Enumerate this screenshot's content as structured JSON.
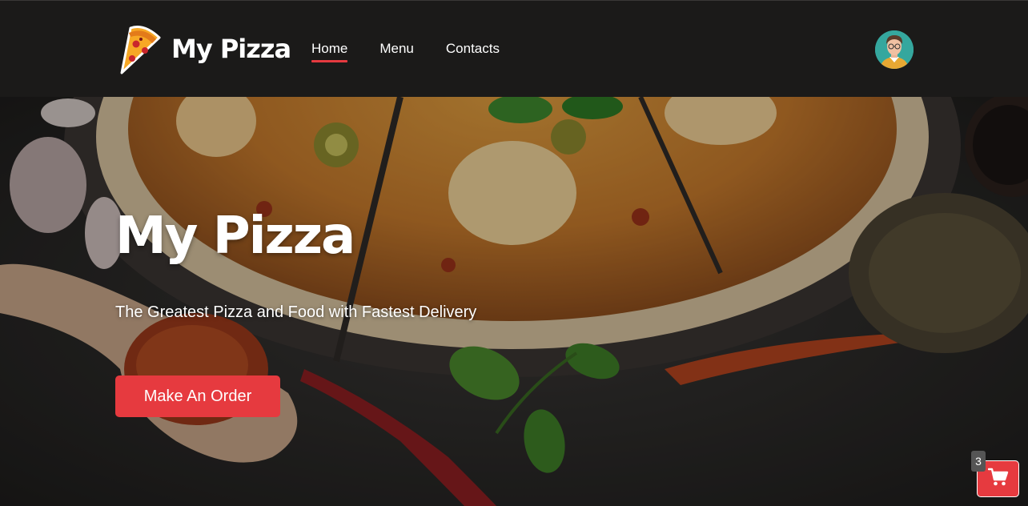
{
  "brand": {
    "name": "My Pizza",
    "icon": "pizza-slice-icon"
  },
  "nav": {
    "items": [
      {
        "label": "Home",
        "active": true
      },
      {
        "label": "Menu",
        "active": false
      },
      {
        "label": "Contacts",
        "active": false
      }
    ]
  },
  "user": {
    "avatar": "user-avatar"
  },
  "hero": {
    "title": "My Pizza",
    "subtitle": "The Greatest Pizza and Food with Fastest Delivery",
    "cta_label": "Make An Order",
    "background": "pizza-photo"
  },
  "cart": {
    "count": "3",
    "icon": "shopping-cart-icon"
  },
  "colors": {
    "header_bg": "#1b1a19",
    "accent": "#e63a3f",
    "text": "#ffffff",
    "badge_bg": "#555555"
  }
}
